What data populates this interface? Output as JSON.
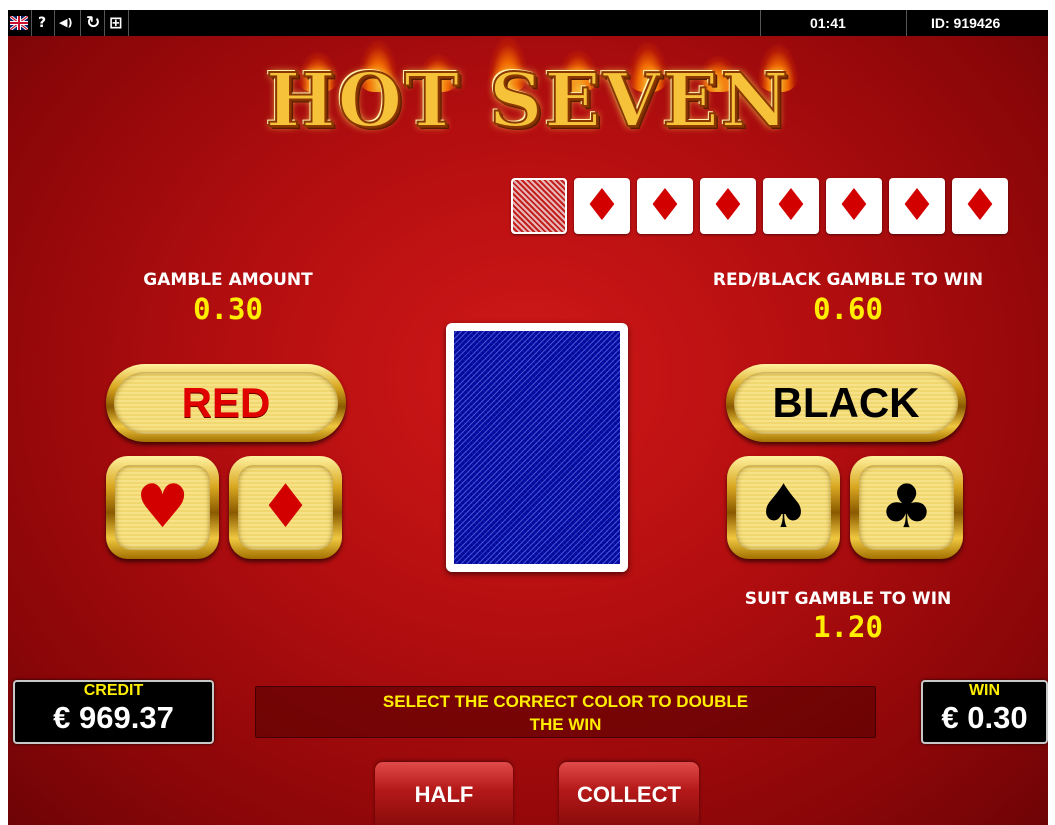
{
  "topbar": {
    "icons": [
      "uk-flag-icon",
      "help-icon",
      "sound-icon",
      "refresh-icon",
      "fullscreen-icon"
    ],
    "help_glyph": "?",
    "sound_glyph": "◀)",
    "refresh_glyph": "↻",
    "fullscreen_glyph": "⊞",
    "time": "01:41",
    "game_id": "ID: 919426"
  },
  "title": "HOT SEVEN",
  "history": {
    "current": "card-back",
    "cards": [
      "♦",
      "♦",
      "♦",
      "♦",
      "♦",
      "♦",
      "♦"
    ]
  },
  "gamble_amount": {
    "label": "GAMBLE AMOUNT",
    "value": "0.30"
  },
  "red_black": {
    "label": "RED/BLACK GAMBLE TO WIN",
    "value": "0.60"
  },
  "suit_gamble": {
    "label": "SUIT GAMBLE TO WIN",
    "value": "1.20"
  },
  "buttons": {
    "red": "RED",
    "black": "BLACK",
    "hearts": "♥",
    "diamonds": "♦",
    "spades": "♠",
    "clubs": "♣",
    "half": "HALF",
    "collect": "COLLECT"
  },
  "credit": {
    "label": "CREDIT",
    "value": "€ 969.37"
  },
  "win": {
    "label": "WIN",
    "value": "€ 0.30"
  },
  "message": {
    "line1": "SELECT THE CORRECT COLOR TO DOUBLE",
    "line2": "THE WIN"
  },
  "colors": {
    "red_text": "#e00000",
    "black_text": "#000000",
    "yellow": "#ffee00",
    "card_back": "#2a3ad0"
  }
}
